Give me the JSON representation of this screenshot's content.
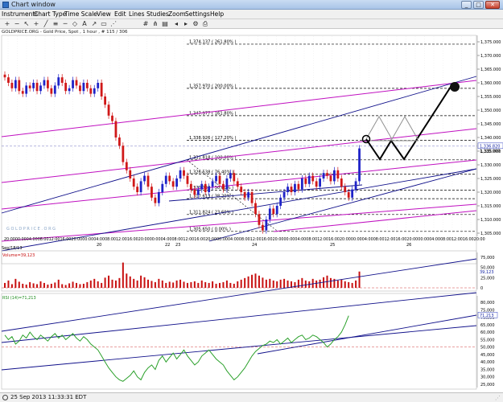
{
  "window": {
    "title": "Chart window",
    "minimize": "_",
    "maximize": "□",
    "close": "✕"
  },
  "menu": [
    "Instruments",
    "Chart Type",
    "Time Scale",
    "View",
    "Edit",
    "Lines",
    "Studies",
    "Zoom",
    "Settings",
    "Help"
  ],
  "toolbar_icons": [
    "zoom-in-icon",
    "zoom-out-icon",
    "pointer-icon",
    "crosshair-icon",
    "trendline-icon",
    "fib-icon",
    "line-icon",
    "shape-icon",
    "text-icon",
    "arrow-icon",
    "rectangle-icon",
    "fan-icon",
    "channel-icon",
    "pitchfork-icon",
    "properties-icon"
  ],
  "chart_header": "GOLDPRICE.ORG - Gold Price, Spot , 1 hour , # 115 / 306",
  "fib_levels": [
    {
      "price": 1374.137,
      "label": "1,374.137 ( 261.80% )"
    },
    {
      "price": 1357.97,
      "label": "1,357.970 ( 200.00% )"
    },
    {
      "price": 1347.977,
      "label": "1,347.977 ( 161.80% )"
    },
    {
      "price": 1338.926,
      "label": "1,338.926 ( 127.20% )"
    },
    {
      "price": 1331.818,
      "label": "1,331.818 ( 100.00% )"
    },
    {
      "price": 1326.538,
      "label": "1,326.538 ( 76.40% )"
    },
    {
      "price": 1320.73,
      "label": "1,320.730 ( 50.00% )"
    },
    {
      "price": 1317.613,
      "label": "1,317.613 ( 38.20% )"
    },
    {
      "price": 1311.824,
      "label": "1,311.824 ( 23.60% )"
    },
    {
      "price": 1305.65,
      "label": "1,305.650 ( 0.00% )"
    }
  ],
  "price_axis": {
    "ticks": [
      "1,375.000",
      "1,370.000",
      "1,365.000",
      "1,360.000",
      "1,355.000",
      "1,350.000",
      "1,345.000",
      "1,340.000",
      "1,335.000",
      "1,330.000",
      "1,325.000",
      "1,320.000",
      "1,315.000",
      "1,310.000",
      "1,305.000"
    ],
    "current_price": "1,336.820",
    "current_price_2": "1,335.000"
  },
  "time_axis": {
    "hour_labels": [
      "20:00",
      "00:00",
      "04:00",
      "08:00",
      "12:00",
      "16:00",
      "20:00",
      "00:00",
      "04:00",
      "08:00",
      "12:00",
      "16:00",
      "20:00",
      "00:00",
      "04:00",
      "08:00",
      "12:00",
      "16:00",
      "20:00",
      "00:00",
      "04:00",
      "08:00",
      "12:00",
      "16:00",
      "20:00",
      "00:00",
      "04:00",
      "08:00",
      "12:00",
      "16:00",
      "20:00",
      "00:00",
      "04:00",
      "08:00",
      "12:00",
      "16:00",
      "20:00",
      "00:00",
      "04:00",
      "08:00",
      "12:00",
      "16:00",
      "20:00"
    ],
    "day_labels": [
      "20",
      "22",
      "23",
      "24",
      "25",
      "26"
    ],
    "month_label": "Sep/18/13"
  },
  "watermark": "G O L D P R I C E . O R G",
  "volume_panel": {
    "label": "Volume=39,123",
    "ticks": [
      "75,000",
      "50,000",
      "25,000",
      "0"
    ],
    "current": "39,123"
  },
  "rsi_panel": {
    "label": "RSI (14)=71,213",
    "ticks": [
      "80,000",
      "75,000",
      "70,000",
      "65,000",
      "60,000",
      "55,000",
      "50,000",
      "45,000",
      "40,000",
      "35,000",
      "30,000",
      "25,000"
    ],
    "current": "71,213"
  },
  "status": {
    "text": "25 Sep 2013 11:33:31 EDT"
  },
  "colors": {
    "bull": "#1f23c8",
    "bear": "#d01818",
    "blue_channel": "#10108a",
    "magenta_channel": "#c010c0",
    "volume": "#c81010",
    "rsi": "#2aa02a",
    "fib_line": "#000000"
  }
}
